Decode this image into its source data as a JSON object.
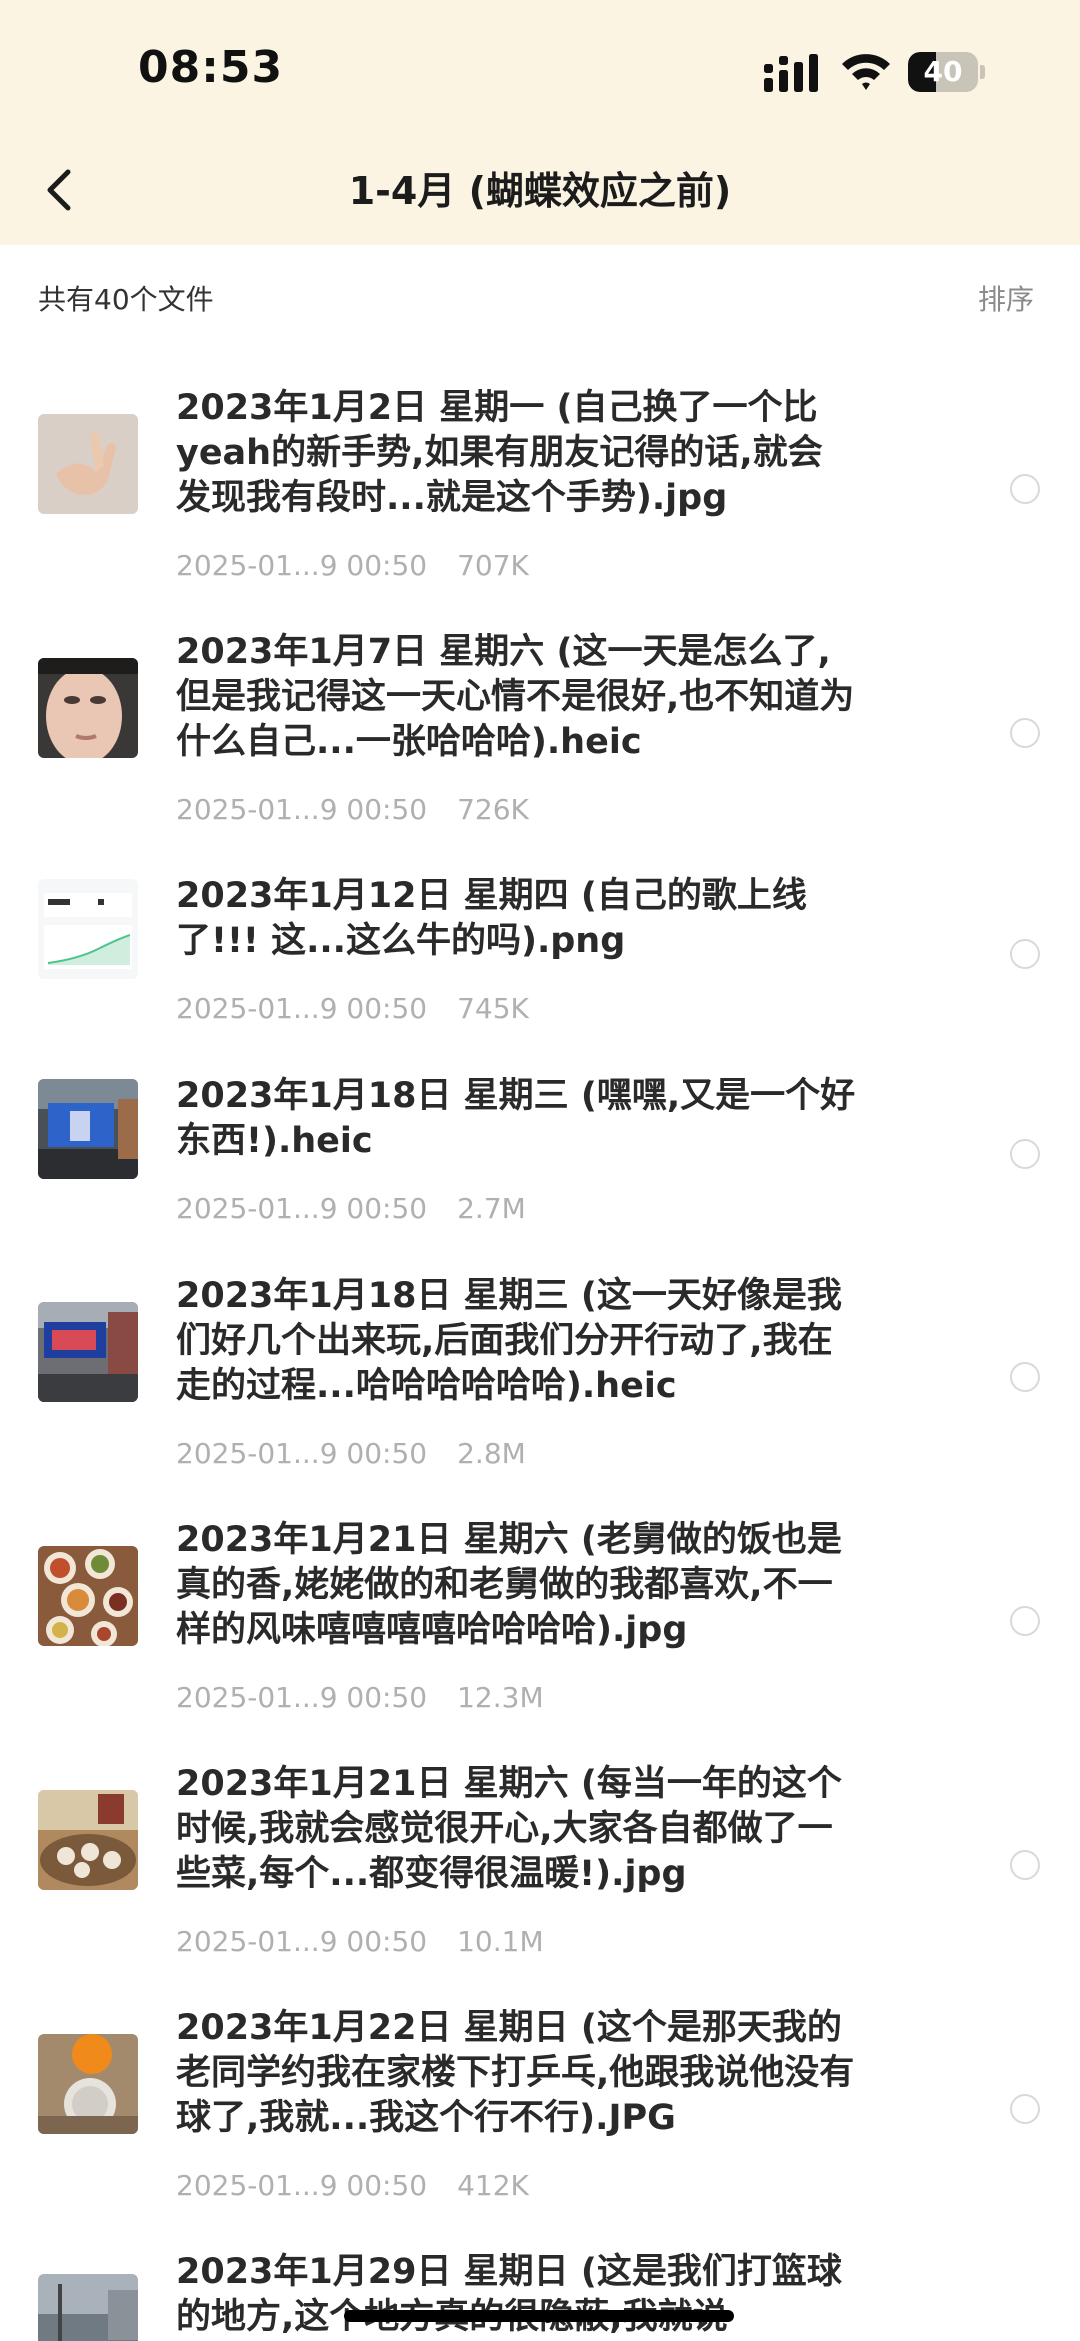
{
  "status_bar": {
    "time": "08:53",
    "battery_level": "40",
    "battery_fraction": 0.4
  },
  "nav": {
    "title": "1-4月 (蝴蝶效应之前)",
    "back_icon": "chevron-left-icon"
  },
  "list_header": {
    "summary": "共有40个文件",
    "sort_label": "排序"
  },
  "files": [
    {
      "title": "2023年1月2日 星期一 (自己换了一个比yeah的新手势,如果有朋友记得的话,就会发现我有段时...就是这个手势).jpg",
      "date": "2025-01...9 00:50",
      "size": "707K",
      "thumb": "hand-photo"
    },
    {
      "title": "2023年1月7日 星期六 (这一天是怎么了,但是我记得这一天心情不是很好,也不知道为什么自己...一张哈哈哈).heic",
      "date": "2025-01...9 00:50",
      "size": "726K",
      "thumb": "face-photo"
    },
    {
      "title": "2023年1月12日 星期四 (自己的歌上线了!!! 这...这么牛的吗).png",
      "date": "2025-01...9 00:50",
      "size": "745K",
      "thumb": "stats-screenshot"
    },
    {
      "title": "2023年1月18日 星期三 (嘿嘿,又是一个好东西!).heic",
      "date": "2025-01...9 00:50",
      "size": "2.7M",
      "thumb": "billboard-photo"
    },
    {
      "title": "2023年1月18日 星期三 (这一天好像是我们好几个出来玩,后面我们分开行动了,我在走的过程...哈哈哈哈哈哈).heic",
      "date": "2025-01...9 00:50",
      "size": "2.8M",
      "thumb": "street-screen-photo"
    },
    {
      "title": "2023年1月21日 星期六 (老舅做的饭也是真的香,姥姥做的和老舅做的我都喜欢,不一样的风味嘻嘻嘻嘻哈哈哈哈).jpg",
      "date": "2025-01...9 00:50",
      "size": "12.3M",
      "thumb": "dishes-photo"
    },
    {
      "title": "2023年1月21日 星期六 (每当一年的这个时候,我就会感觉很开心,大家各自都做了一些菜,每个...都变得很温暖!).jpg",
      "date": "2025-01...9 00:50",
      "size": "10.1M",
      "thumb": "dinner-table-photo"
    },
    {
      "title": "2023年1月22日 星期日 (这个是那天我的老同学约我在家楼下打乒乓,他跟我说他没有球了,我就...我这个行不行).JPG",
      "date": "2025-01...9 00:50",
      "size": "412K",
      "thumb": "pingpong-photo"
    },
    {
      "title": "2023年1月29日 星期日 (这是我们打篮球的地方,这个地方真的很隐蔽,我就说",
      "date": "",
      "size": "",
      "thumb": "court-photo"
    }
  ],
  "colors": {
    "header_bg": "#fbf4e2",
    "meta_text": "#b0b0b0",
    "title_text": "#2a2a2a"
  }
}
